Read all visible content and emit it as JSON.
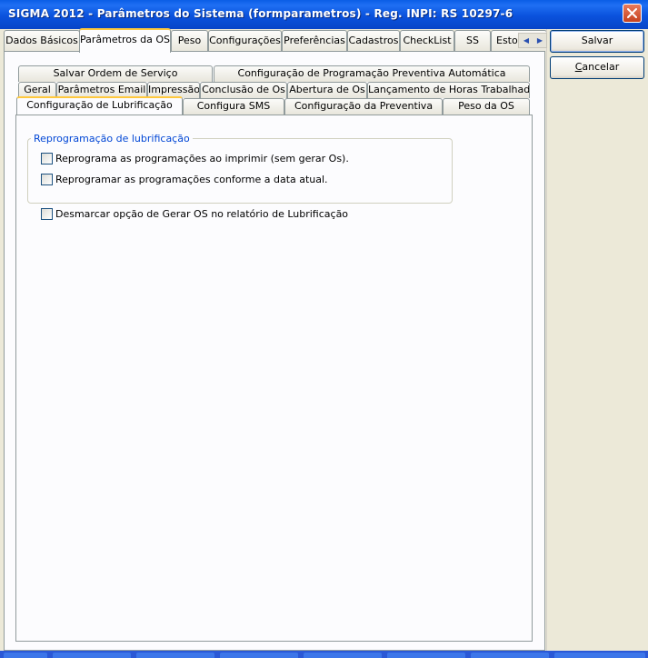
{
  "window": {
    "title": "SIGMA 2012 - Parâmetros do Sistema  (formparametros)  - Reg. INPI: RS 10297-6",
    "close_icon": "close-icon"
  },
  "top_tabs": [
    {
      "label": "Dados Básicos"
    },
    {
      "label": "Parâmetros da OS"
    },
    {
      "label": "Peso"
    },
    {
      "label": "Configurações"
    },
    {
      "label": "Preferências"
    },
    {
      "label": "Cadastros"
    },
    {
      "label": "CheckList"
    },
    {
      "label": "SS"
    },
    {
      "label": "Estoque"
    }
  ],
  "inner_tabs": {
    "row1": [
      {
        "label": "Salvar Ordem de Serviço"
      },
      {
        "label": "Configuração de Programação Preventiva Automática"
      }
    ],
    "row2": [
      {
        "label": "Geral"
      },
      {
        "label": "Parâmetros Email"
      },
      {
        "label": "Impressão"
      },
      {
        "label": "Conclusão de Os"
      },
      {
        "label": "Abertura de Os"
      },
      {
        "label": "Lançamento de Horas Trabalhadas"
      }
    ],
    "row3": [
      {
        "label": "Configuração de Lubrificação"
      },
      {
        "label": "Configura SMS"
      },
      {
        "label": "Configuração da Preventiva"
      },
      {
        "label": "Peso da OS"
      }
    ]
  },
  "group": {
    "title": "Reprogramação de lubrificação",
    "options": [
      {
        "label": "Reprograma as programações ao imprimir (sem gerar Os).",
        "checked": false
      },
      {
        "label": "Reprogramar as programações conforme a data atual.",
        "checked": false
      }
    ]
  },
  "standalone_option": {
    "label": "Desmarcar opção de Gerar OS no relatório de Lubrificação",
    "checked": false
  },
  "buttons": {
    "save": "Salvar",
    "cancel_prefix": "C",
    "cancel_rest": "ancelar"
  },
  "colors": {
    "titlebar": "#0a52dd",
    "active_tab_accent": "#ffc83c",
    "group_title": "#0046d5",
    "window_bg": "#ece9d8"
  }
}
